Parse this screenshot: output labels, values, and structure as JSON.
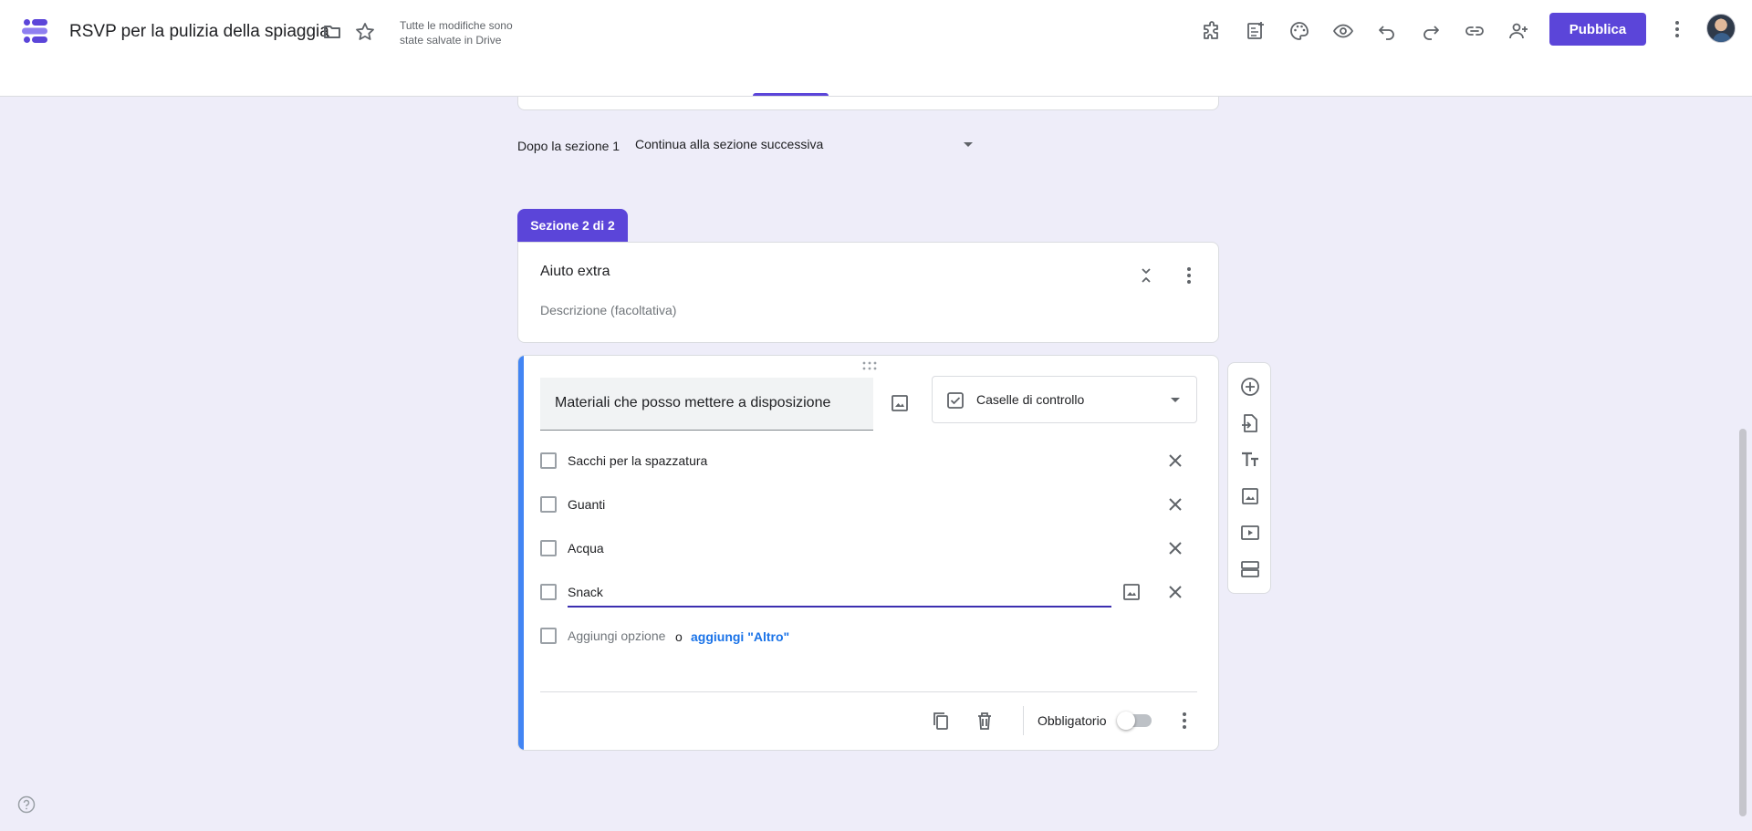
{
  "header": {
    "title": "RSVP per la pulizia della spiaggia",
    "save_status": "Tutte le modifiche sono state salvate in Drive",
    "publish_label": "Pubblica"
  },
  "after_section": {
    "label": "Dopo la sezione 1",
    "value": "Continua alla sezione successiva"
  },
  "section": {
    "tab_label": "Sezione 2 di 2",
    "title": "Aiuto extra",
    "description_placeholder": "Descrizione (facoltativa)"
  },
  "question": {
    "title": "Materiali che posso mettere a disposizione",
    "type": "Caselle di controllo",
    "options": [
      "Sacchi per la spazzatura",
      "Guanti",
      "Acqua",
      "Snack"
    ],
    "add_option": "Aggiungi opzione",
    "or": "o",
    "add_other": "aggiungi \"Altro\"",
    "required_label": "Obbligatorio",
    "required": false
  },
  "colors": {
    "accent": "#5b45d9",
    "question_bar": "#4285f4",
    "link": "#1a73e8",
    "background": "#eeedf9"
  },
  "icons": {
    "header": [
      "forms-logo-icon",
      "folder-icon",
      "star-icon",
      "addon-icon",
      "customize-theme-icon",
      "palette-icon",
      "preview-icon",
      "undo-icon",
      "redo-icon",
      "link-icon",
      "add-collaborator-icon",
      "more-vert-icon"
    ],
    "toolbar": [
      "add-question-icon",
      "import-questions-icon",
      "add-title-icon",
      "add-image-icon",
      "add-video-icon",
      "add-section-icon"
    ]
  }
}
